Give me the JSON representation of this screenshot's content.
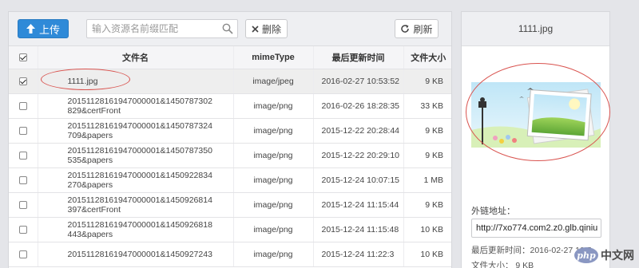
{
  "toolbar": {
    "upload_label": "上传",
    "search_placeholder": "输入资源名前缀匹配",
    "delete_label": "删除",
    "refresh_label": "刷新"
  },
  "table": {
    "headers": {
      "name": "文件名",
      "mime": "mimeType",
      "time": "最后更新时间",
      "size": "文件大小"
    },
    "rows": [
      {
        "checked": true,
        "name1": "1111.jpg",
        "name2": "",
        "mime": "image/jpeg",
        "time": "2016-02-27 10:53:52",
        "size": "9 KB"
      },
      {
        "checked": false,
        "name1": "20151128161947000001&1450787302",
        "name2": "829&certFront",
        "mime": "image/png",
        "time": "2016-02-26 18:28:35",
        "size": "33 KB"
      },
      {
        "checked": false,
        "name1": "20151128161947000001&1450787324",
        "name2": "709&papers",
        "mime": "image/png",
        "time": "2015-12-22 20:28:44",
        "size": "9 KB"
      },
      {
        "checked": false,
        "name1": "20151128161947000001&1450787350",
        "name2": "535&papers",
        "mime": "image/png",
        "time": "2015-12-22 20:29:10",
        "size": "9 KB"
      },
      {
        "checked": false,
        "name1": "20151128161947000001&1450922834",
        "name2": "270&papers",
        "mime": "image/png",
        "time": "2015-12-24 10:07:15",
        "size": "1 MB"
      },
      {
        "checked": false,
        "name1": "20151128161947000001&1450926814",
        "name2": "397&certFront",
        "mime": "image/png",
        "time": "2015-12-24 11:15:44",
        "size": "9 KB"
      },
      {
        "checked": false,
        "name1": "20151128161947000001&1450926818",
        "name2": "443&papers",
        "mime": "image/png",
        "time": "2015-12-24 11:15:48",
        "size": "10 KB"
      },
      {
        "checked": false,
        "name1": "20151128161947000001&1450927243",
        "name2": "",
        "mime": "image/png",
        "time": "2015-12-24 11:22:3",
        "size": "10 KB"
      }
    ]
  },
  "preview": {
    "title": "1111.jpg",
    "link_label": "外链地址：",
    "link_value": "http://7xo774.com2.z0.glb.qiniu",
    "updated": "最后更新时间：2016-02-27 10:5",
    "size": "文件大小：  9 KB"
  },
  "watermark": {
    "logo": "php",
    "text": "中文网"
  }
}
